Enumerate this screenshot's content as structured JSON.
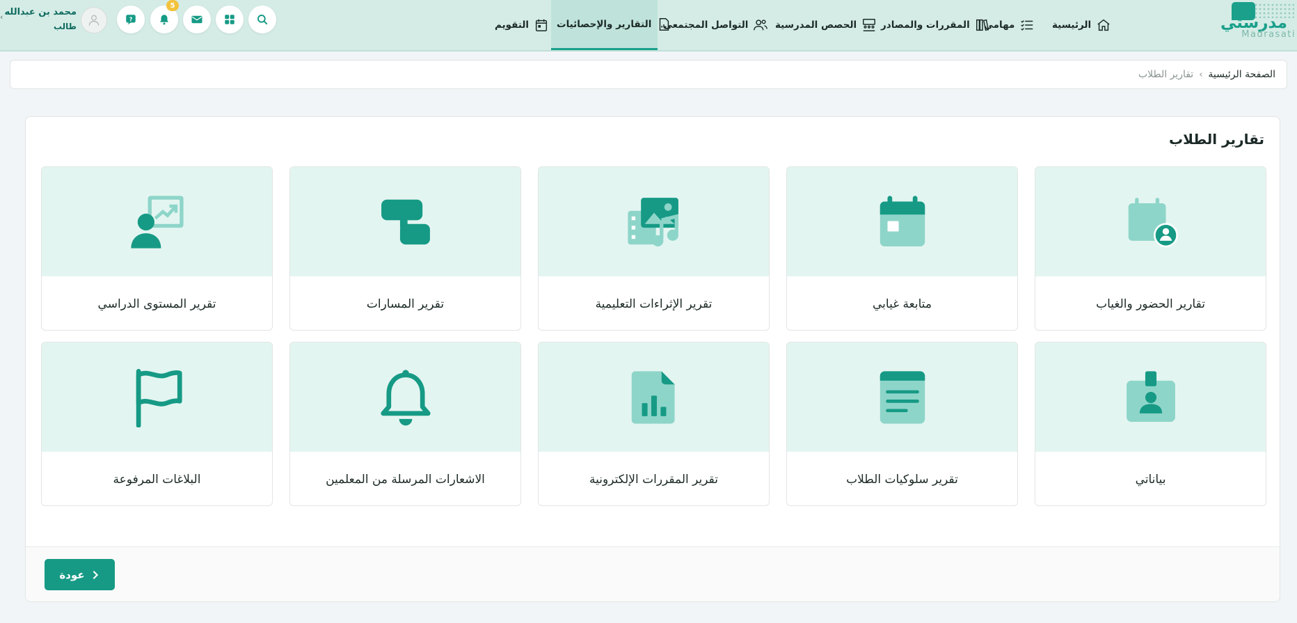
{
  "logo": {
    "arabic": "مدرستي",
    "latin": "Madrasati"
  },
  "nav": {
    "items": [
      {
        "label": "الرئيسية",
        "icon": "home-icon"
      },
      {
        "label": "مهامي",
        "icon": "tasks-icon"
      },
      {
        "label": "المقررات والمصادر",
        "icon": "books-icon"
      },
      {
        "label": "الحصص المدرسية",
        "icon": "classroom-icon"
      },
      {
        "label": "التواصل المجتمعي",
        "icon": "community-icon"
      },
      {
        "label": "التقارير والإحصائيات",
        "icon": "report-icon",
        "active": true
      },
      {
        "label": "التقويم",
        "icon": "calendar-icon"
      }
    ]
  },
  "toolbar": {
    "notification_count": "5",
    "icons": [
      "search-icon",
      "apps-grid-icon",
      "mail-icon",
      "bell-icon",
      "help-icon"
    ]
  },
  "user": {
    "name": "محمد بن عبدالله",
    "role": "طالب"
  },
  "breadcrumb": {
    "home": "الصفحة الرئيسية",
    "separator": "›",
    "current": "تقارير الطلاب"
  },
  "page": {
    "title": "تقارير الطلاب",
    "cards": [
      {
        "label": "تقارير الحضور والغياب",
        "icon": "attendance-calendar-icon"
      },
      {
        "label": "متابعة غيابي",
        "icon": "calendar-day-icon"
      },
      {
        "label": "تقرير الإثراءات التعليمية",
        "icon": "media-enrichment-icon"
      },
      {
        "label": "تقرير المسارات",
        "icon": "paths-icon"
      },
      {
        "label": "تقرير المستوى الدراسي",
        "icon": "student-progress-icon"
      },
      {
        "label": "بياناتي",
        "icon": "id-badge-icon"
      },
      {
        "label": "تقرير سلوكيات الطلاب",
        "icon": "notes-icon"
      },
      {
        "label": "تقرير المقررات الإلكترونية",
        "icon": "file-chart-icon"
      },
      {
        "label": "الاشعارات المرسلة من المعلمين",
        "icon": "bell-outline-icon"
      },
      {
        "label": "البلاغات المرفوعة",
        "icon": "flag-icon"
      }
    ]
  },
  "footer": {
    "back_label": "عودة"
  },
  "colors": {
    "accent": "#1aa08b",
    "accent_dark": "#169a85",
    "accent_light": "#8ed5c9",
    "topbar": "#d5ece6",
    "card_top": "#e3f5f1"
  }
}
